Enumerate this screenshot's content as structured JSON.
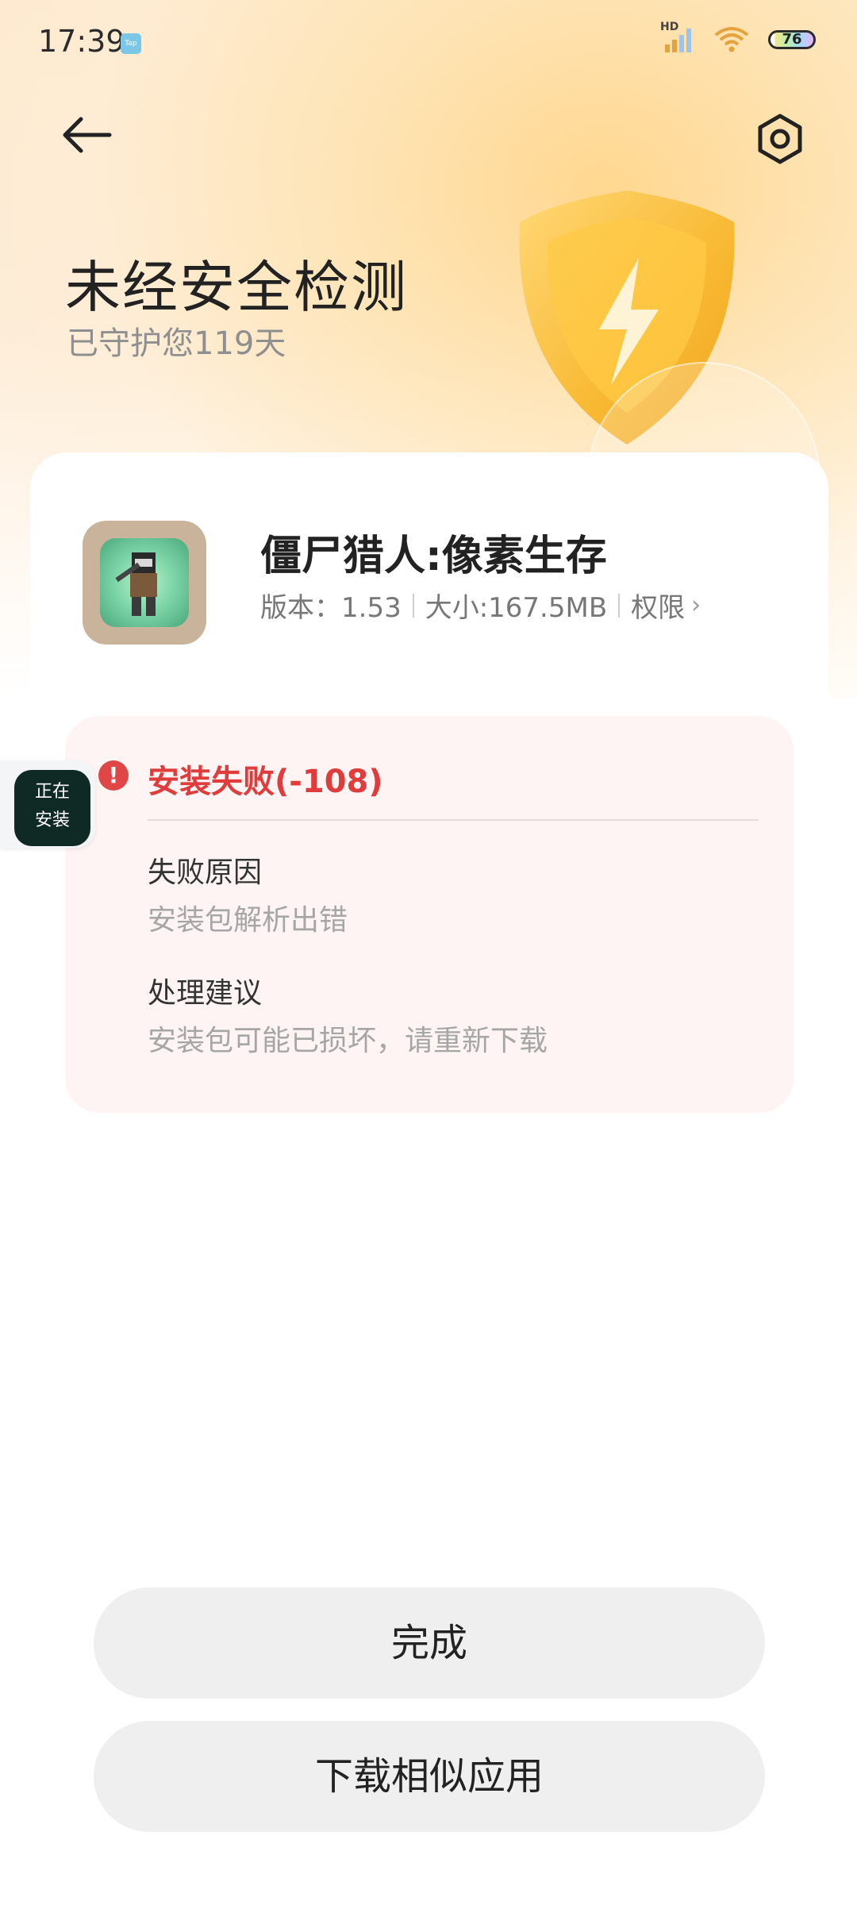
{
  "status_bar": {
    "time": "17:39",
    "app_icon_label": "Tap",
    "signal_label": "HD",
    "battery_level": "76"
  },
  "header": {
    "title": "未经安全检测",
    "subtitle": "已守护您119天"
  },
  "app": {
    "name": "僵尸猎人:像素生存",
    "version": "版本：1.53",
    "size": "大小:167.5MB",
    "permissions_label": "权限"
  },
  "error": {
    "title": "安装失败(-108)",
    "reason_label": "失败原因",
    "reason_value": "安装包解析出错",
    "suggestion_label": "处理建议",
    "suggestion_value": "安装包可能已损坏，请重新下载"
  },
  "floating_badge": {
    "line1": "正在",
    "line2": "安装"
  },
  "buttons": {
    "done": "完成",
    "download_similar": "下载相似应用"
  },
  "colors": {
    "error_red": "#e03c3c",
    "shield_gold": "#f8b62b",
    "error_panel_bg": "#fff4f4"
  }
}
